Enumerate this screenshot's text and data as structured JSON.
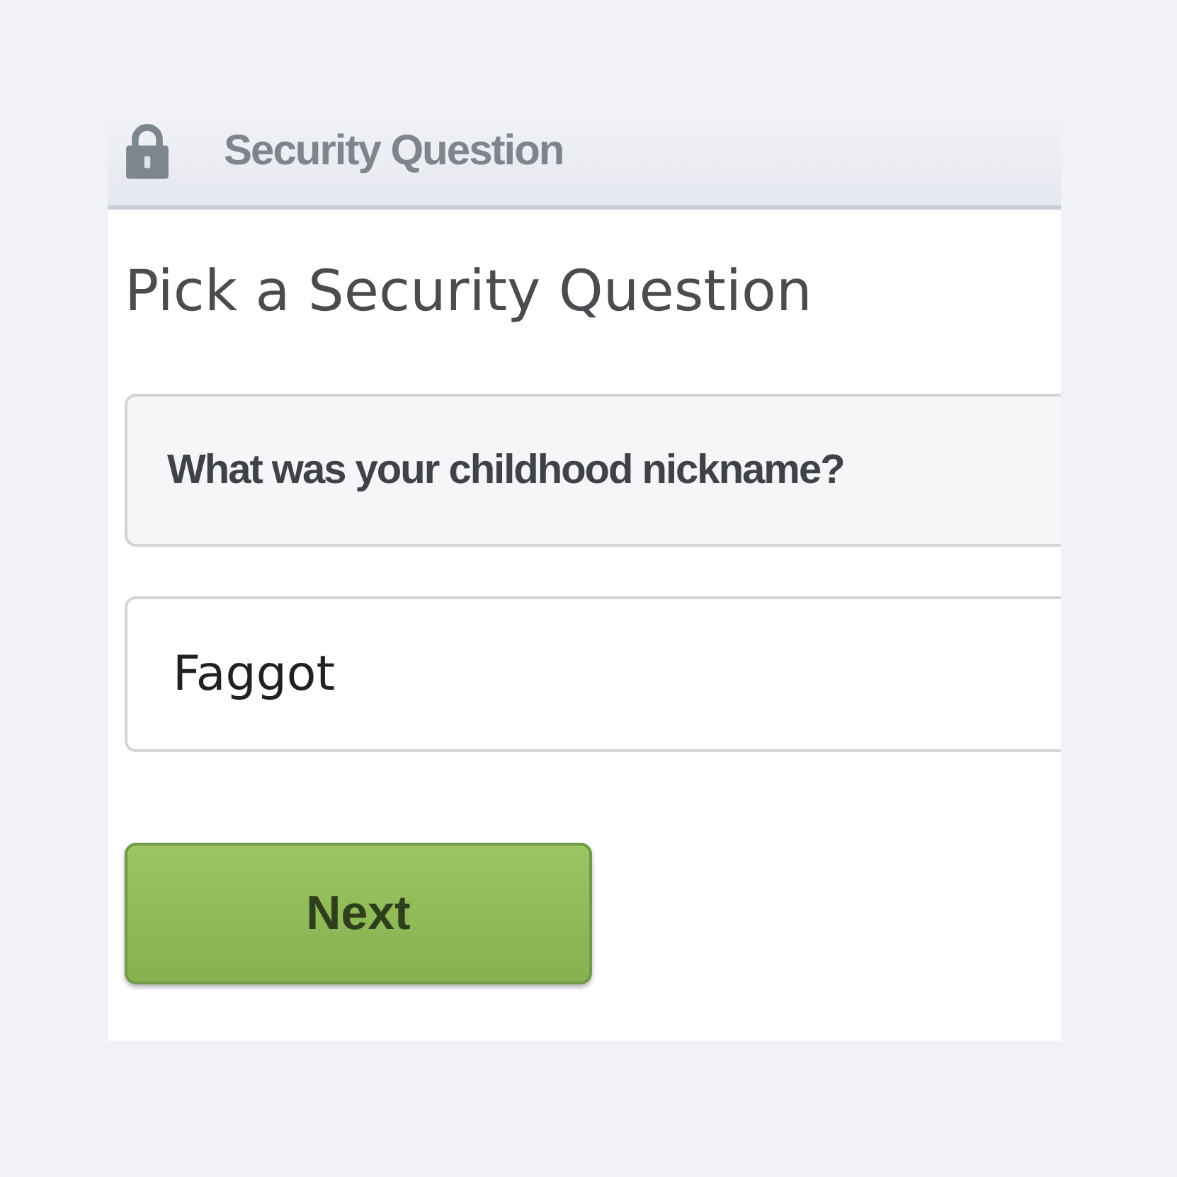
{
  "window": {
    "title": "Security Question"
  },
  "heading": "Pick a Security Question",
  "question_select": {
    "value": "What was your childhood nickname?"
  },
  "answer_field": {
    "value": "Faggot"
  },
  "buttons": [
    "Next"
  ]
}
